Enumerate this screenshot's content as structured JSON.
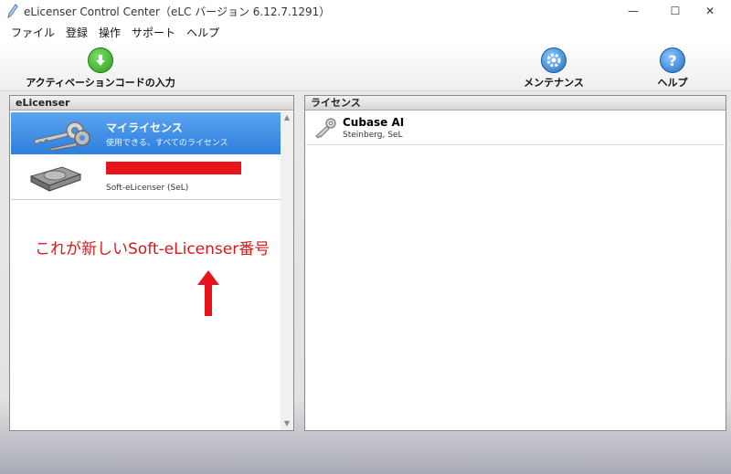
{
  "window": {
    "title": "eLicenser Control Center（eLC バージョン 6.12.7.1291）",
    "minimize_glyph": "—",
    "maximize_glyph": "☐",
    "close_glyph": "✕"
  },
  "menu": {
    "items": [
      "ファイル",
      "登録",
      "操作",
      "サポート",
      "ヘルプ"
    ]
  },
  "toolbar": {
    "activate_label": "アクティベーションコードの入力",
    "maintenance_label": "メンテナンス",
    "help_label": "ヘルプ",
    "activate_icon": "download-arrow-icon",
    "maintenance_icon": "gear-icon",
    "help_icon": "question-icon"
  },
  "left_panel": {
    "header": "eLicenser",
    "items": [
      {
        "name": "マイライセンス",
        "sub": "使用できる、すべてのライセンス",
        "icon": "keys-icon",
        "selected": true
      },
      {
        "name": "",
        "sub": "Soft-eLicenser (SeL)",
        "icon": "hard-drive-icon",
        "selected": false,
        "name_redacted": true
      }
    ]
  },
  "right_panel": {
    "header": "ライセンス",
    "licenses": [
      {
        "name": "Cubase AI",
        "vendor": "Steinberg, SeL",
        "icon": "key-icon"
      }
    ]
  },
  "annotation": {
    "text": "これが新しいSoft-eLicenser番号",
    "color": "#d41b1b"
  },
  "colors": {
    "selection": "#2d7fdd",
    "redaction": "#e8141c"
  }
}
